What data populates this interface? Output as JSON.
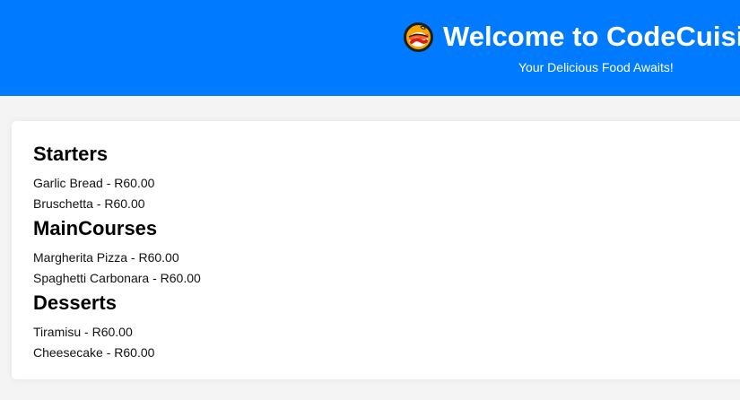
{
  "header": {
    "title": "Welcome to CodeCuisine",
    "subtitle": "Your Delicious Food Awaits!",
    "icon": "noodle-bowl-icon"
  },
  "menu": {
    "sections": [
      {
        "title": "Starters",
        "items": [
          "Garlic Bread - R60.00",
          "Bruschetta - R60.00"
        ]
      },
      {
        "title": "MainCourses",
        "items": [
          "Margherita Pizza - R60.00",
          "Spaghetti Carbonara - R60.00"
        ]
      },
      {
        "title": "Desserts",
        "items": [
          "Tiramisu - R60.00",
          "Cheesecake - R60.00"
        ]
      }
    ]
  },
  "colors": {
    "header_background": "#007bff",
    "page_background": "#f4f4f4",
    "card_background": "#ffffff"
  }
}
